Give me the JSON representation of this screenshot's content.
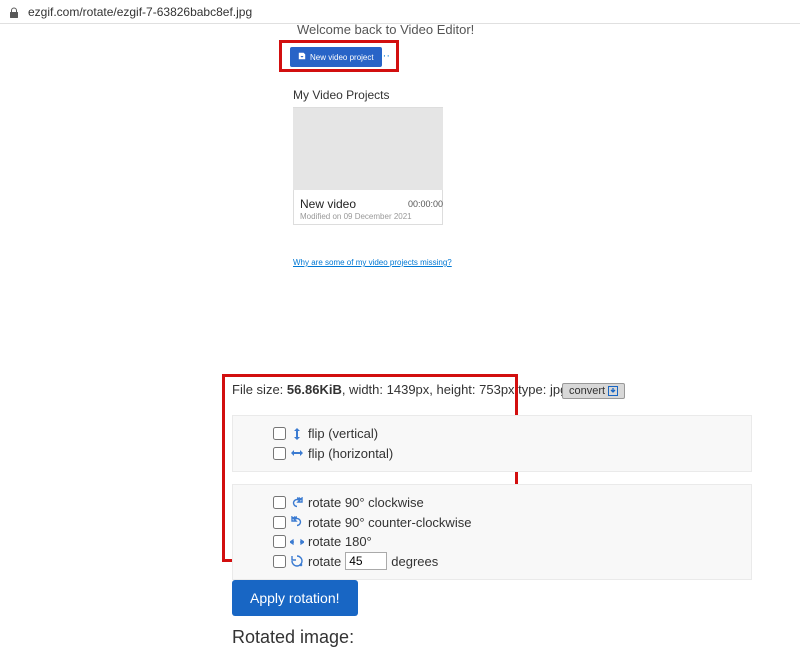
{
  "url": "ezgif.com/rotate/ezgif-7-63826babc8ef.jpg",
  "editor": {
    "welcome": "Welcome back to Video Editor!",
    "new_project_btn": "New video project",
    "projects_label": "My Video Projects",
    "project": {
      "name": "New video",
      "duration": "00:00:00",
      "modified": "Modified on 09 December 2021"
    },
    "missing_link": "Why are some of my video projects missing?"
  },
  "fileinfo": {
    "size_label": "File size: ",
    "size": "56.86KiB",
    "width": ", width: 1439px, height: 753px",
    "type_label": " type: jpg",
    "convert": "convert"
  },
  "options": {
    "flip_v": "flip (vertical)",
    "flip_h": "flip (horizontal)",
    "rot_cw": "rotate 90° clockwise",
    "rot_ccw": "rotate 90° counter-clockwise",
    "rot_180": "rotate 180°",
    "rot_custom_prefix": "rotate",
    "rot_custom_value": "45",
    "rot_custom_suffix": "degrees"
  },
  "apply_btn": "Apply rotation!",
  "rotated_heading": "Rotated image:"
}
